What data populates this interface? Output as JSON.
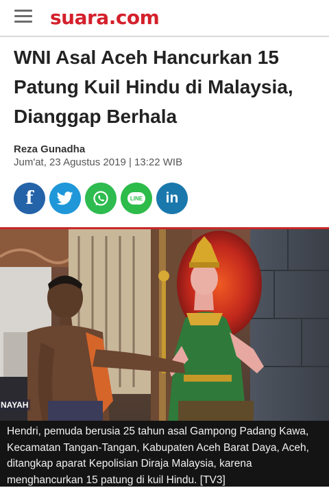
{
  "header": {
    "logo_text": "suara.com",
    "menu_icon": "hamburger-menu-icon",
    "brand_color": "#d4202b"
  },
  "article": {
    "title": "WNI Asal Aceh Hancurkan 15 Patung Kuil Hindu di Malaysia, Dianggap Berhala",
    "author": "Reza Gunadha",
    "date": "Jum'at, 23 Agustus 2019 | 13:22 WIB"
  },
  "share": [
    {
      "name": "facebook-icon",
      "label": "f",
      "color": "#2563a8"
    },
    {
      "name": "twitter-icon",
      "label": "",
      "color": "#1f97d8"
    },
    {
      "name": "whatsapp-icon",
      "label": "",
      "color": "#2ebb4f"
    },
    {
      "name": "line-icon",
      "label": "LINE",
      "color": "#2dbb4a"
    },
    {
      "name": "linkedin-icon",
      "label": "in",
      "color": "#1a78ad"
    }
  ],
  "photo": {
    "watermark": "NAYAH",
    "caption": "Hendri, pemuda berusia 25 tahun asal Gampong Padang Kawa, Kecamatan Tangan-Tangan, Kabupaten Aceh Barat Daya, Aceh, ditangkap aparat Kepolisian Diraja Malaysia, karena menghancurkan 15 patung di kuil Hindu. [TV3]"
  }
}
